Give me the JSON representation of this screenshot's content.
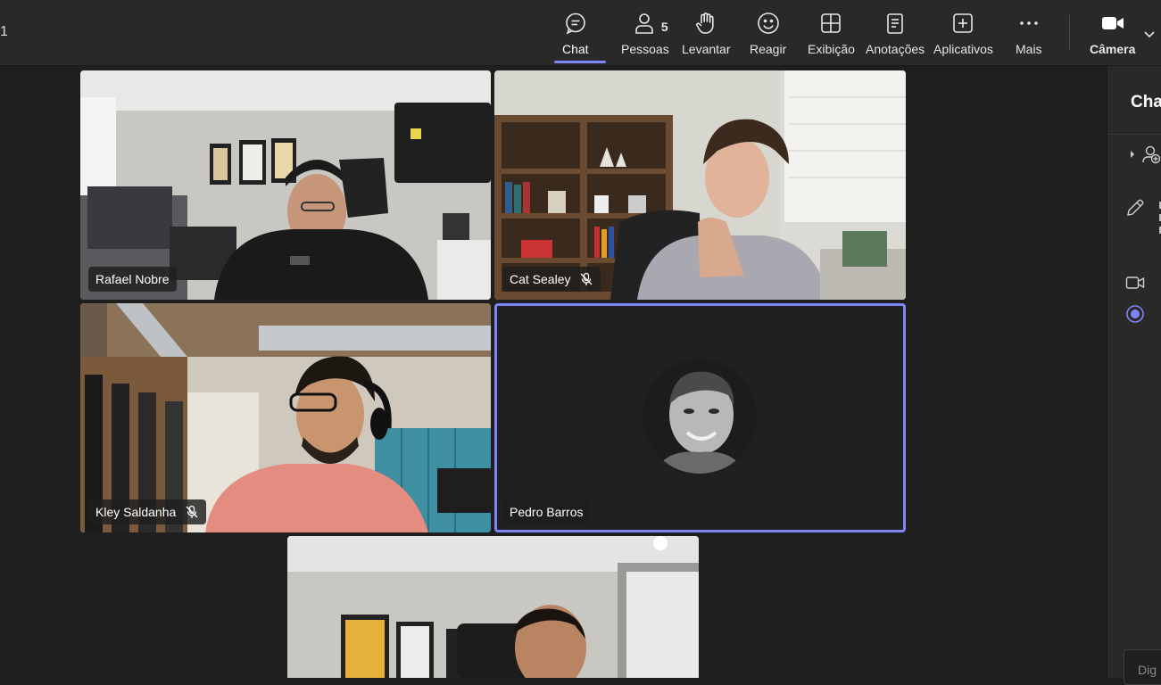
{
  "window": {
    "left_fragment": "1"
  },
  "toolbar": {
    "chat": "Chat",
    "people": "Pessoas",
    "people_count": "5",
    "raise_hand": "Levantar",
    "react": "Reagir",
    "view": "Exibição",
    "notes": "Anotações",
    "apps": "Aplicativos",
    "more": "Mais",
    "camera": "Câmera"
  },
  "participants": [
    {
      "name": "Rafael Nobre",
      "muted": false
    },
    {
      "name": "Cat Sealey",
      "muted": true
    },
    {
      "name": "Kley Saldanha",
      "muted": true
    },
    {
      "name": "Pedro Barros",
      "muted": false,
      "speaking": true
    },
    {
      "name": "",
      "self_view": true
    }
  ],
  "right_panel": {
    "title": "Cha",
    "compose_placeholder": "Dig"
  },
  "colors": {
    "accent": "#7f85f5",
    "toolbar_bg": "#292929",
    "stage_bg": "#1f1f1f"
  }
}
